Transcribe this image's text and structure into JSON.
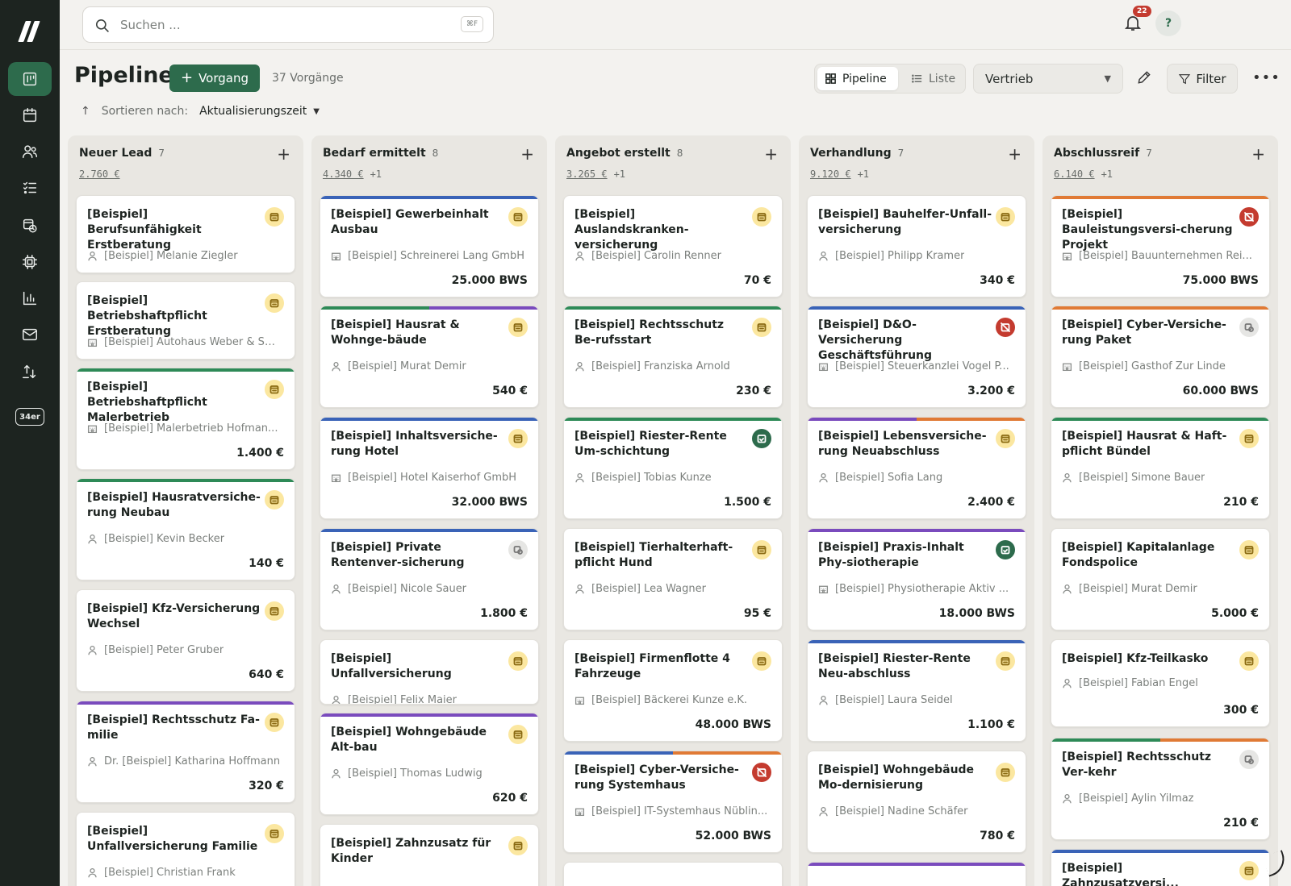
{
  "search": {
    "placeholder": "Suchen ...",
    "shortcut": "⌘F"
  },
  "notifications": {
    "count": "22"
  },
  "help": {
    "label": "?"
  },
  "nav": {
    "badge": "34er"
  },
  "header": {
    "title": "Pipeline",
    "add_label": "Vorgang",
    "count": "37 Vorgänge",
    "view_pipeline": "Pipeline",
    "view_list": "Liste",
    "select_value": "Vertrieb",
    "filter_label": "Filter",
    "sort_label": "Sortieren nach:",
    "sort_value": "Aktualisierungszeit"
  },
  "colors": {
    "accent": "#2d6b4c",
    "blue": "#3a63b7",
    "green": "#2e8a57",
    "purple": "#7a4bbd",
    "orange": "#e07a35"
  },
  "columns": [
    {
      "title": "Neuer Lead",
      "count": "7",
      "sum": "2.760 €",
      "extra": "",
      "cards": [
        {
          "title": "[Beispiel] Berufsunfähigkeit Erstberatung",
          "sub": "[Beispiel] Melanie Ziegler",
          "subtype": "person",
          "amount": "",
          "icon": "yellow",
          "bars": []
        },
        {
          "title": "[Beispiel] Betriebshaftpflicht Erstberatung",
          "sub": "[Beispiel] Autohaus Weber & Sö...",
          "subtype": "org",
          "amount": "",
          "icon": "yellow",
          "bars": []
        },
        {
          "title": "[Beispiel] Betriebshaftpflicht Malerbetrieb",
          "sub": "[Beispiel] Malerbetrieb Hofman...",
          "subtype": "org",
          "amount": "1.400 €",
          "icon": "yellow",
          "bars": [
            "green"
          ]
        },
        {
          "title": "[Beispiel] Hausratversiche-rung Neubau",
          "sub": "[Beispiel] Kevin Becker",
          "subtype": "person",
          "amount": "140 €",
          "icon": "yellow",
          "bars": [
            "green"
          ]
        },
        {
          "title": "[Beispiel] Kfz-Versicherung Wechsel",
          "sub": "[Beispiel] Peter Gruber",
          "subtype": "person",
          "amount": "640 €",
          "icon": "yellow",
          "bars": []
        },
        {
          "title": "[Beispiel] Rechtsschutz Fa-milie",
          "sub": "Dr. [Beispiel] Katharina Hoffmann",
          "subtype": "person",
          "amount": "320 €",
          "icon": "yellow",
          "bars": [
            "purple"
          ]
        },
        {
          "title": "[Beispiel] Unfallversicherung Familie",
          "sub": "[Beispiel] Christian Frank",
          "subtype": "person",
          "amount": "",
          "icon": "yellow",
          "bars": []
        }
      ]
    },
    {
      "title": "Bedarf ermittelt",
      "count": "8",
      "sum": "4.340 €",
      "extra": "+1",
      "cards": [
        {
          "title": "[Beispiel] Gewerbeinhalt Ausbau",
          "sub": "[Beispiel] Schreinerei Lang GmbH",
          "subtype": "org",
          "amount": "25.000 BWS",
          "icon": "yellow",
          "bars": [
            "blue"
          ]
        },
        {
          "title": "[Beispiel] Hausrat & Wohnge-bäude",
          "sub": "[Beispiel] Murat Demir",
          "subtype": "person",
          "amount": "540 €",
          "icon": "yellow",
          "bars": [
            "green",
            "purple"
          ]
        },
        {
          "title": "[Beispiel] Inhaltsversiche-rung Hotel",
          "sub": "[Beispiel] Hotel Kaiserhof GmbH",
          "subtype": "org",
          "amount": "32.000 BWS",
          "icon": "yellow",
          "bars": [
            "blue"
          ]
        },
        {
          "title": "[Beispiel] Private Rentenver-sicherung",
          "sub": "[Beispiel] Nicole Sauer",
          "subtype": "person",
          "amount": "1.800 €",
          "icon": "gray",
          "bars": [
            "blue"
          ]
        },
        {
          "title": "[Beispiel] Unfallversicherung",
          "sub": "[Beispiel] Felix Maier",
          "subtype": "person",
          "amount": "",
          "icon": "yellow",
          "bars": []
        },
        {
          "title": "[Beispiel] Wohngebäude Alt-bau",
          "sub": "[Beispiel] Thomas Ludwig",
          "subtype": "person",
          "amount": "620 €",
          "icon": "yellow",
          "bars": [
            "purple"
          ]
        },
        {
          "title": "[Beispiel] Zahnzusatz für Kinder",
          "sub": "",
          "subtype": "person",
          "amount": "",
          "icon": "yellow",
          "bars": []
        }
      ]
    },
    {
      "title": "Angebot erstellt",
      "count": "8",
      "sum": "3.265 €",
      "extra": "+1",
      "cards": [
        {
          "title": "[Beispiel] Auslandskranken-versicherung",
          "sub": "[Beispiel] Carolin Renner",
          "subtype": "person",
          "amount": "70 €",
          "icon": "yellow",
          "bars": []
        },
        {
          "title": "[Beispiel] Rechtsschutz Be-rufsstart",
          "sub": "[Beispiel] Franziska Arnold",
          "subtype": "person",
          "amount": "230 €",
          "icon": "yellow",
          "bars": [
            "green"
          ]
        },
        {
          "title": "[Beispiel] Riester-Rente Um-schichtung",
          "sub": "[Beispiel] Tobias Kunze",
          "subtype": "person",
          "amount": "1.500 €",
          "icon": "green",
          "bars": [
            "green"
          ]
        },
        {
          "title": "[Beispiel] Tierhalterhaft-pflicht Hund",
          "sub": "[Beispiel] Lea Wagner",
          "subtype": "person",
          "amount": "95 €",
          "icon": "yellow",
          "bars": []
        },
        {
          "title": "[Beispiel] Firmenflotte 4 Fahrzeuge",
          "sub": "[Beispiel] Bäckerei Kunze e.K.",
          "subtype": "org",
          "amount": "48.000 BWS",
          "icon": "yellow",
          "bars": []
        },
        {
          "title": "[Beispiel] Cyber-Versiche-rung Systemhaus",
          "sub": "[Beispiel] IT-Systemhaus Nüblin...",
          "subtype": "org",
          "amount": "52.000 BWS",
          "icon": "red",
          "bars": [
            "blue",
            "orange"
          ]
        },
        {
          "title": "",
          "sub": "",
          "subtype": "person",
          "amount": "",
          "icon": "",
          "bars": []
        }
      ]
    },
    {
      "title": "Verhandlung",
      "count": "7",
      "sum": "9.120 €",
      "extra": "+1",
      "cards": [
        {
          "title": "[Beispiel] Bauhelfer-Unfall-versicherung",
          "sub": "[Beispiel] Philipp Kramer",
          "subtype": "person",
          "amount": "340 €",
          "icon": "yellow",
          "bars": []
        },
        {
          "title": "[Beispiel] D&O-Versicherung Geschäftsführung",
          "sub": "[Beispiel] Steuerkanzlei Vogel P...",
          "subtype": "org",
          "amount": "3.200 €",
          "icon": "red",
          "bars": [
            "blue"
          ]
        },
        {
          "title": "[Beispiel] Lebensversiche-rung Neuabschluss",
          "sub": "[Beispiel] Sofia Lang",
          "subtype": "person",
          "amount": "2.400 €",
          "icon": "yellow",
          "bars": [
            "purple",
            "orange"
          ]
        },
        {
          "title": "[Beispiel] Praxis-Inhalt Phy-siotherapie",
          "sub": "[Beispiel] Physiotherapie Aktiv ...",
          "subtype": "org",
          "amount": "18.000 BWS",
          "icon": "green",
          "bars": [
            "purple"
          ]
        },
        {
          "title": "[Beispiel] Riester-Rente Neu-abschluss",
          "sub": "[Beispiel] Laura Seidel",
          "subtype": "person",
          "amount": "1.100 €",
          "icon": "yellow",
          "bars": [
            "blue"
          ]
        },
        {
          "title": "[Beispiel] Wohngebäude Mo-dernisierung",
          "sub": "[Beispiel] Nadine Schäfer",
          "subtype": "person",
          "amount": "780 €",
          "icon": "yellow",
          "bars": []
        },
        {
          "title": "",
          "sub": "",
          "subtype": "person",
          "amount": "",
          "icon": "",
          "bars": [
            "purple"
          ]
        }
      ]
    },
    {
      "title": "Abschlussreif",
      "count": "7",
      "sum": "6.140 €",
      "extra": "+1",
      "cards": [
        {
          "title": "[Beispiel] Bauleistungsversi-cherung Projekt",
          "sub": "[Beispiel] Bauunternehmen Rei...",
          "subtype": "org",
          "amount": "75.000 BWS",
          "icon": "red",
          "bars": [
            "orange"
          ]
        },
        {
          "title": "[Beispiel] Cyber-Versiche-rung Paket",
          "sub": "[Beispiel] Gasthof Zur Linde",
          "subtype": "org",
          "amount": "60.000 BWS",
          "icon": "gray",
          "bars": [
            "orange"
          ]
        },
        {
          "title": "[Beispiel] Hausrat & Haft-pflicht Bündel",
          "sub": "[Beispiel] Simone Bauer",
          "subtype": "person",
          "amount": "210 €",
          "icon": "yellow",
          "bars": [
            "green"
          ]
        },
        {
          "title": "[Beispiel] Kapitalanlage Fondspolice",
          "sub": "[Beispiel] Murat Demir",
          "subtype": "person",
          "amount": "5.000 €",
          "icon": "yellow",
          "bars": []
        },
        {
          "title": "[Beispiel] Kfz-Teilkasko",
          "sub": "[Beispiel] Fabian Engel",
          "subtype": "person",
          "amount": "300 €",
          "icon": "yellow",
          "bars": []
        },
        {
          "title": "[Beispiel] Rechtsschutz Ver-kehr",
          "sub": "[Beispiel] Aylin Yilmaz",
          "subtype": "person",
          "amount": "210 €",
          "icon": "gray",
          "bars": [
            "green",
            "orange"
          ]
        },
        {
          "title": "[Beispiel] Zahnzusatzversi...",
          "sub": "",
          "subtype": "person",
          "amount": "",
          "icon": "yellow",
          "bars": [
            "blue"
          ]
        }
      ]
    }
  ]
}
